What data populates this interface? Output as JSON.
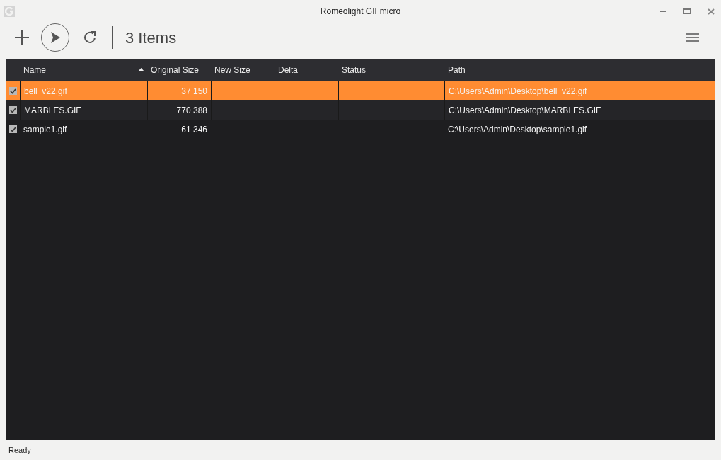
{
  "window": {
    "title": "Romeolight GIFmicro"
  },
  "toolbar": {
    "item_count": "3 Items"
  },
  "table": {
    "columns": [
      {
        "label": "Name",
        "sorted": true
      },
      {
        "label": "Original Size",
        "sorted": false
      },
      {
        "label": "New Size",
        "sorted": false
      },
      {
        "label": "Delta",
        "sorted": false
      },
      {
        "label": "Status",
        "sorted": false
      },
      {
        "label": "Path",
        "sorted": false
      }
    ],
    "rows": [
      {
        "checked": true,
        "selected": true,
        "cells": [
          "bell_v22.gif",
          "37 150",
          "",
          "",
          "",
          "C:\\Users\\Admin\\Desktop\\bell_v22.gif"
        ]
      },
      {
        "checked": true,
        "selected": false,
        "cells": [
          "MARBLES.GIF",
          "770 388",
          "",
          "",
          "",
          "C:\\Users\\Admin\\Desktop\\MARBLES.GIF"
        ]
      },
      {
        "checked": true,
        "selected": false,
        "cells": [
          "sample1.gif",
          "61 346",
          "",
          "",
          "",
          "C:\\Users\\Admin\\Desktop\\sample1.gif"
        ]
      }
    ]
  },
  "status_bar": "Ready"
}
